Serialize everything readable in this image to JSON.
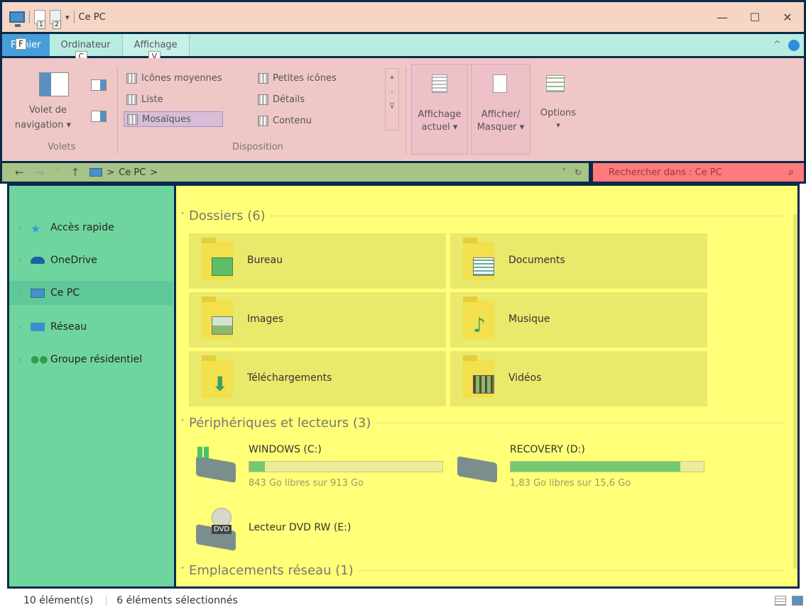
{
  "titlebar": {
    "title": "Ce PC",
    "qa_key_1": "1",
    "qa_key_2": "2",
    "minimize": "—",
    "maximize": "☐",
    "close": "✕"
  },
  "tabs": {
    "file": "Fichier",
    "file_key": "F",
    "computer": "Ordinateur",
    "computer_key": "C",
    "view": "Affichage",
    "view_key": "V",
    "collapse": "^"
  },
  "ribbon": {
    "panes_group": {
      "nav_pane_label_1": "Volet de",
      "nav_pane_label_2": "navigation ▾",
      "group_label": "Volets"
    },
    "layout_group": {
      "items": [
        "Icônes moyennes",
        "Petites icônes",
        "Liste",
        "Détails",
        "Mosaïques",
        "Contenu"
      ],
      "group_label": "Disposition",
      "scroll_up": "▴",
      "scroll_down": "▾",
      "expand": "⊽"
    },
    "current_view": {
      "line1": "Affichage",
      "line2": "actuel ▾"
    },
    "show_hide": {
      "line1": "Afficher/",
      "line2": "Masquer ▾"
    },
    "options": {
      "line1": "Options",
      "line2": "▾"
    }
  },
  "addressbar": {
    "back": "←",
    "forward": "→",
    "recent": "˅",
    "up": "↑",
    "sep1": ">",
    "location": "Ce PC",
    "sep2": ">",
    "dropdown": "˅",
    "refresh": "↻"
  },
  "search": {
    "placeholder": "Rechercher dans : Ce PC",
    "icon": "⌕"
  },
  "navpane": {
    "items": [
      {
        "label": "Accès rapide",
        "icon": "star-icon",
        "color": "#2a9fd6"
      },
      {
        "label": "OneDrive",
        "icon": "cloud-icon",
        "color": "#1e5fa8"
      },
      {
        "label": "Ce PC",
        "icon": "computer-icon",
        "color": "#4a90c8"
      },
      {
        "label": "Réseau",
        "icon": "network-icon",
        "color": "#3a8fd0"
      },
      {
        "label": "Groupe résidentiel",
        "icon": "homegroup-icon",
        "color": "#2e9e4f"
      }
    ]
  },
  "content": {
    "folders_header": "Dossiers (6)",
    "folders": [
      "Bureau",
      "Documents",
      "Images",
      "Musique",
      "Téléchargements",
      "Vidéos"
    ],
    "devices_header": "Périphériques et lecteurs (3)",
    "drives": [
      {
        "name": "WINDOWS (C:)",
        "free": "843 Go libres sur 913 Go",
        "used_fraction": 0.08
      },
      {
        "name": "RECOVERY (D:)",
        "free": "1,83 Go libres sur 15,6 Go",
        "used_fraction": 0.88
      }
    ],
    "dvd": {
      "name": "Lecteur DVD RW (E:)",
      "badge": "DVD"
    },
    "network_header": "Emplacements réseau (1)"
  },
  "statusbar": {
    "count": "10 élément(s)",
    "selected": "6 éléments sélectionnés"
  },
  "colors": {
    "accent": "#2e8fd6",
    "drive_fill": "#74c971"
  }
}
